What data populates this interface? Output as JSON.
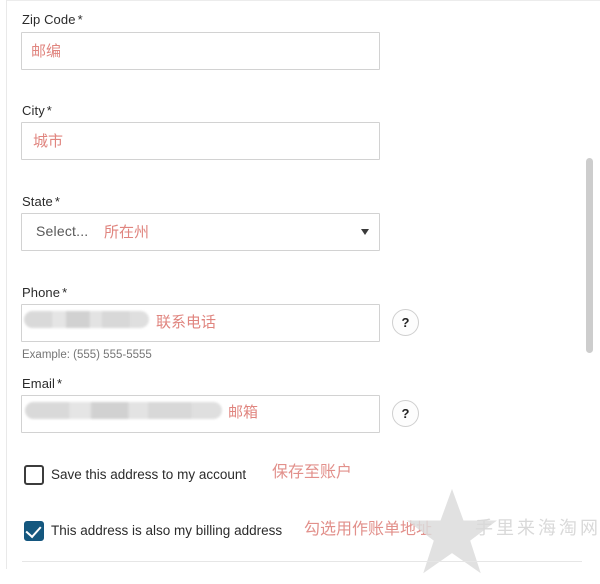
{
  "form": {
    "fields": [
      {
        "key": "zip",
        "label": "Zip Code",
        "required_marker": "*",
        "value": "",
        "annotation": "邮编",
        "helper": ""
      },
      {
        "key": "city",
        "label": "City",
        "required_marker": "*",
        "value": "",
        "annotation": "城市",
        "helper": ""
      },
      {
        "key": "state",
        "label": "State",
        "required_marker": "*",
        "selected_option": "Select...",
        "annotation": "所在州",
        "caret_icon": "chevron-down-icon",
        "helper": ""
      },
      {
        "key": "phone",
        "label": "Phone",
        "required_marker": "*",
        "value": "",
        "annotation": "联系电话",
        "helper": "Example: (555) 555-5555",
        "help_button": "?"
      },
      {
        "key": "email",
        "label": "Email",
        "required_marker": "*",
        "value": "",
        "annotation": "邮箱",
        "helper": "",
        "help_button": "?"
      }
    ],
    "checkboxes": [
      {
        "key": "save-address",
        "label": "Save this address to my account",
        "annotation": "保存至账户",
        "checked": false
      },
      {
        "key": "billing-address",
        "label": "This address is also my billing address",
        "annotation": "勾选用作账单地址",
        "checked": true
      }
    ]
  },
  "watermark": {
    "text": "手里来海淘网",
    "icon": "star-icon"
  },
  "colors": {
    "annotation_red": "#e0857f",
    "checkbox_checked_blue": "#15587f",
    "input_border": "#d2d2d2",
    "label_text": "#2b2b2b",
    "helper_text": "#767676",
    "watermark_grey": "#d9d9d9",
    "scrollbar_thumb": "#cdcdcd"
  }
}
